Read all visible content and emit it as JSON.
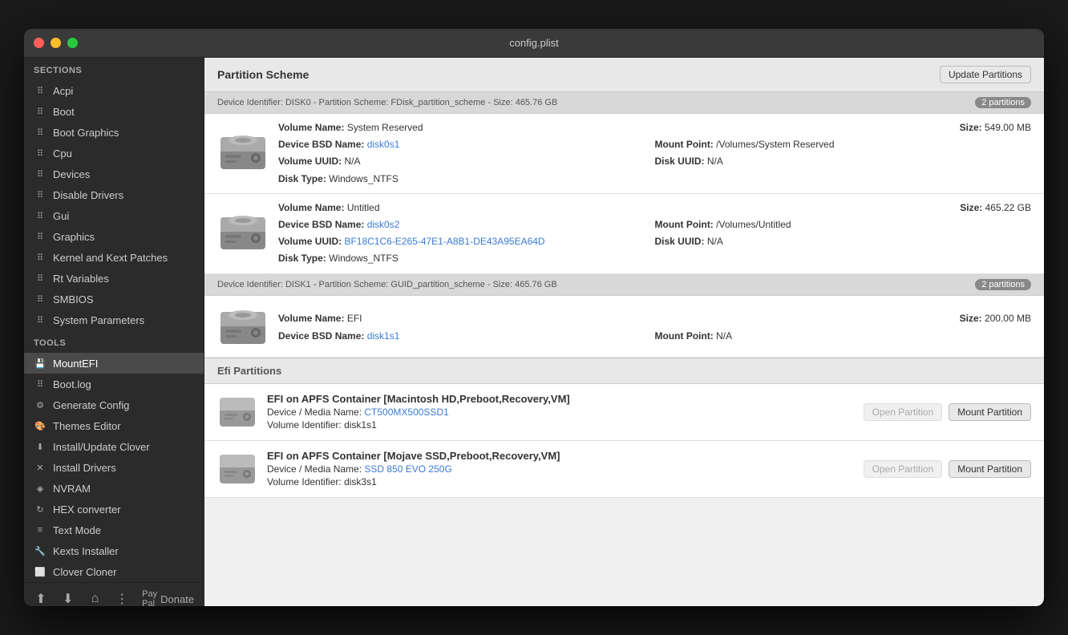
{
  "window": {
    "title": "config.plist"
  },
  "sidebar": {
    "sections_label": "SECTIONS",
    "tools_label": "TOOLS",
    "sections": [
      {
        "id": "acpi",
        "label": "Acpi",
        "icon": "list"
      },
      {
        "id": "boot",
        "label": "Boot",
        "icon": "list"
      },
      {
        "id": "boot-graphics",
        "label": "Boot Graphics",
        "icon": "list"
      },
      {
        "id": "cpu",
        "label": "Cpu",
        "icon": "list"
      },
      {
        "id": "devices",
        "label": "Devices",
        "icon": "list"
      },
      {
        "id": "disable-drivers",
        "label": "Disable Drivers",
        "icon": "list"
      },
      {
        "id": "gui",
        "label": "Gui",
        "icon": "list"
      },
      {
        "id": "graphics",
        "label": "Graphics",
        "icon": "list"
      },
      {
        "id": "kernel-kext",
        "label": "Kernel and Kext Patches",
        "icon": "list"
      },
      {
        "id": "rt-variables",
        "label": "Rt Variables",
        "icon": "list"
      },
      {
        "id": "smbios",
        "label": "SMBIOS",
        "icon": "list"
      },
      {
        "id": "system-parameters",
        "label": "System Parameters",
        "icon": "list"
      }
    ],
    "tools": [
      {
        "id": "mount-efi",
        "label": "MountEFI",
        "icon": "hdd",
        "active": true
      },
      {
        "id": "boot-log",
        "label": "Boot.log",
        "icon": "list"
      },
      {
        "id": "generate-config",
        "label": "Generate Config",
        "icon": "gear"
      },
      {
        "id": "themes-editor",
        "label": "Themes Editor",
        "icon": "themes"
      },
      {
        "id": "install-update-clover",
        "label": "Install/Update Clover",
        "icon": "download"
      },
      {
        "id": "install-drivers",
        "label": "Install Drivers",
        "icon": "wrench"
      },
      {
        "id": "nvram",
        "label": "NVRAM",
        "icon": "chip"
      },
      {
        "id": "hex-converter",
        "label": "HEX converter",
        "icon": "refresh"
      },
      {
        "id": "text-mode",
        "label": "Text Mode",
        "icon": "lines"
      },
      {
        "id": "kexts-installer",
        "label": "Kexts Installer",
        "icon": "tool"
      },
      {
        "id": "clover-cloner",
        "label": "Clover Cloner",
        "icon": "copy"
      }
    ]
  },
  "main": {
    "partition_scheme_label": "Partition Scheme",
    "update_partitions_label": "Update Partitions",
    "efi_partitions_label": "Efi Partitions",
    "disks": [
      {
        "identifier": "Device Identifier: DISK0 - Partition Scheme: FDisk_partition_scheme - Size: 465.76 GB",
        "partitions_count": "2 partitions",
        "partitions": [
          {
            "volume_name": "System Reserved",
            "device_bsd": "disk0s1",
            "volume_uuid": "N/A",
            "disk_type": "Windows_NTFS",
            "mount_point": "/Volumes/System Reserved",
            "disk_uuid": "N/A",
            "size": "549.00 MB"
          },
          {
            "volume_name": "Untitled",
            "device_bsd": "disk0s2",
            "volume_uuid": "BF18C1C6-E265-47E1-A8B1-DE43A95EA64D",
            "disk_type": "Windows_NTFS",
            "mount_point": "/Volumes/Untitled",
            "disk_uuid": "N/A",
            "size": "465.22 GB"
          }
        ]
      },
      {
        "identifier": "Device Identifier: DISK1 - Partition Scheme: GUID_partition_scheme - Size: 465.76 GB",
        "partitions_count": "2 partitions",
        "partitions": [
          {
            "volume_name": "EFI",
            "device_bsd": "disk1s1",
            "volume_uuid": "",
            "disk_type": "",
            "mount_point": "N/A",
            "disk_uuid": "",
            "size": "200.00 MB"
          }
        ]
      }
    ],
    "efi_items": [
      {
        "name": "EFI on APFS Container [Macintosh HD,Preboot,Recovery,VM]",
        "device_media": "CT500MX500SSD1",
        "volume_identifier": "disk1s1",
        "open_label": "Open Partition",
        "mount_label": "Mount Partition",
        "open_disabled": true
      },
      {
        "name": "EFI on APFS Container [Mojave SSD,Preboot,Recovery,VM]",
        "device_media": "SSD 850 EVO 250G",
        "volume_identifier": "disk3s1",
        "open_label": "Open Partition",
        "mount_label": "Mount Partition",
        "open_disabled": true
      }
    ]
  }
}
